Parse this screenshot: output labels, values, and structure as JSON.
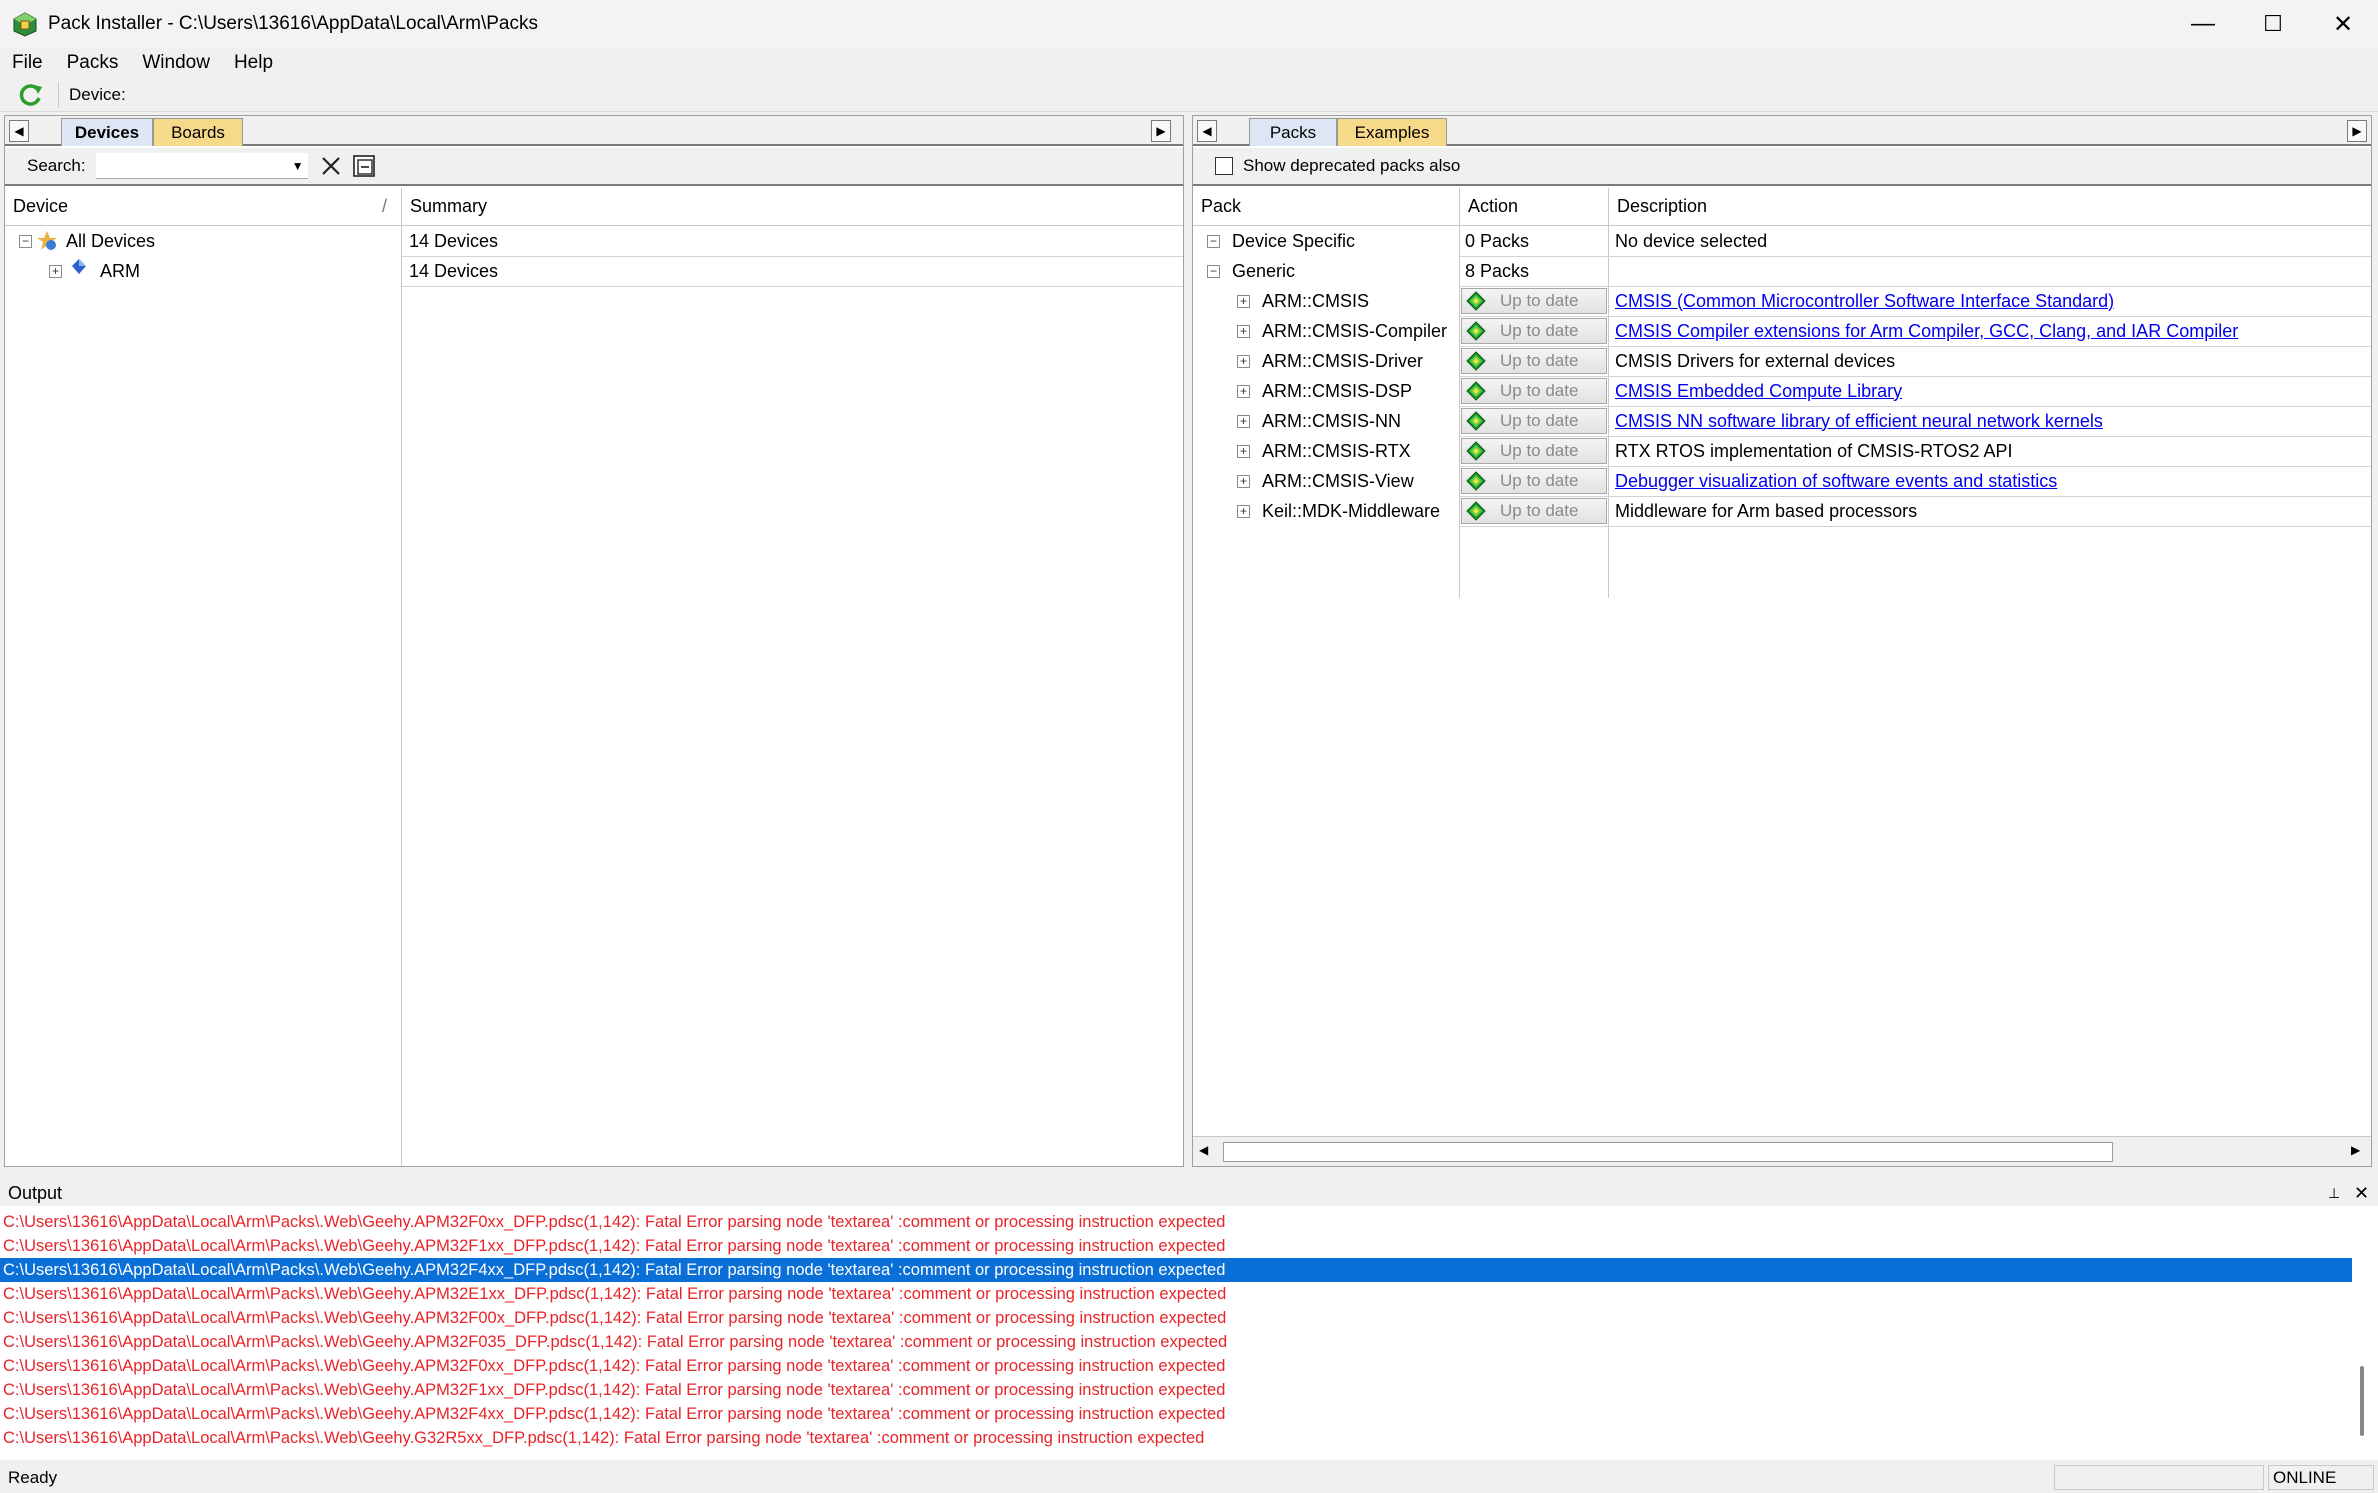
{
  "window": {
    "title": "Pack Installer - C:\\Users\\13616\\AppData\\Local\\Arm\\Packs",
    "minimize_icon": "minimize-icon",
    "maximize_icon": "maximize-icon",
    "close_icon": "close-icon",
    "minimize_glyph": "—",
    "maximize_glyph": "☐",
    "close_glyph": "✕"
  },
  "menu": [
    "File",
    "Packs",
    "Window",
    "Help"
  ],
  "toolbar": {
    "device_label": "Device:"
  },
  "left_pane": {
    "tabs": [
      "Devices",
      "Boards"
    ],
    "search_label": "Search:",
    "search_value": "",
    "headers": {
      "device": "Device",
      "summary": "Summary",
      "sort_glyph": "/"
    },
    "rows": [
      {
        "name": "All Devices",
        "summary": "14 Devices",
        "expander": "−"
      },
      {
        "name": "ARM",
        "summary": "14 Devices",
        "expander": "+"
      }
    ]
  },
  "right_pane": {
    "tabs": [
      "Packs",
      "Examples"
    ],
    "deprecated_label": "Show deprecated packs also",
    "deprecated_checked": false,
    "headers": {
      "pack": "Pack",
      "action": "Action",
      "description": "Description"
    },
    "groups": [
      {
        "name": "Device Specific",
        "action": "0 Packs",
        "description": "No device selected",
        "expander": "−"
      },
      {
        "name": "Generic",
        "action": "8 Packs",
        "description": "",
        "expander": "−"
      }
    ],
    "packs": [
      {
        "name": "ARM::CMSIS",
        "action": "Up to date",
        "description": "CMSIS (Common Microcontroller Software Interface Standard)",
        "link": true
      },
      {
        "name": "ARM::CMSIS-Compiler",
        "action": "Up to date",
        "description": "CMSIS Compiler extensions for Arm Compiler, GCC, Clang, and IAR Compiler",
        "link": true
      },
      {
        "name": "ARM::CMSIS-Driver",
        "action": "Up to date",
        "description": "CMSIS Drivers for external devices",
        "link": false
      },
      {
        "name": "ARM::CMSIS-DSP",
        "action": "Up to date",
        "description": "CMSIS Embedded Compute Library",
        "link": true
      },
      {
        "name": "ARM::CMSIS-NN",
        "action": "Up to date",
        "description": "CMSIS NN software library of efficient neural network kernels",
        "link": true
      },
      {
        "name": "ARM::CMSIS-RTX",
        "action": "Up to date",
        "description": "RTX RTOS implementation of CMSIS-RTOS2 API",
        "link": false
      },
      {
        "name": "ARM::CMSIS-View",
        "action": "Up to date",
        "description": "Debugger visualization of software events and statistics",
        "link": true
      },
      {
        "name": "Keil::MDK-Middleware",
        "action": "Up to date",
        "description": "Middleware for Arm based processors",
        "link": false
      }
    ]
  },
  "output": {
    "title": "Output",
    "lines": [
      "C:\\Users\\13616\\AppData\\Local\\Arm\\Packs\\.Web\\Geehy.APM32F0xx_DFP.pdsc(1,142): Fatal Error parsing node 'textarea' :comment or processing instruction expected",
      "C:\\Users\\13616\\AppData\\Local\\Arm\\Packs\\.Web\\Geehy.APM32F1xx_DFP.pdsc(1,142): Fatal Error parsing node 'textarea' :comment or processing instruction expected",
      "C:\\Users\\13616\\AppData\\Local\\Arm\\Packs\\.Web\\Geehy.APM32F4xx_DFP.pdsc(1,142): Fatal Error parsing node 'textarea' :comment or processing instruction expected",
      "C:\\Users\\13616\\AppData\\Local\\Arm\\Packs\\.Web\\Geehy.APM32E1xx_DFP.pdsc(1,142): Fatal Error parsing node 'textarea' :comment or processing instruction expected",
      "C:\\Users\\13616\\AppData\\Local\\Arm\\Packs\\.Web\\Geehy.APM32F00x_DFP.pdsc(1,142): Fatal Error parsing node 'textarea' :comment or processing instruction expected",
      "C:\\Users\\13616\\AppData\\Local\\Arm\\Packs\\.Web\\Geehy.APM32F035_DFP.pdsc(1,142): Fatal Error parsing node 'textarea' :comment or processing instruction expected",
      "C:\\Users\\13616\\AppData\\Local\\Arm\\Packs\\.Web\\Geehy.APM32F0xx_DFP.pdsc(1,142): Fatal Error parsing node 'textarea' :comment or processing instruction expected",
      "C:\\Users\\13616\\AppData\\Local\\Arm\\Packs\\.Web\\Geehy.APM32F1xx_DFP.pdsc(1,142): Fatal Error parsing node 'textarea' :comment or processing instruction expected",
      "C:\\Users\\13616\\AppData\\Local\\Arm\\Packs\\.Web\\Geehy.APM32F4xx_DFP.pdsc(1,142): Fatal Error parsing node 'textarea' :comment or processing instruction expected",
      "C:\\Users\\13616\\AppData\\Local\\Arm\\Packs\\.Web\\Geehy.G32R5xx_DFP.pdsc(1,142): Fatal Error parsing node 'textarea' :comment or processing instruction expected"
    ],
    "selected_index": 2,
    "pin_glyph": "📌",
    "close_glyph": "✕"
  },
  "status": {
    "text": "Ready",
    "mode": "ONLINE"
  },
  "colors": {
    "error_text": "#e8242a",
    "selection": "#0a6fd6",
    "link": "#0000ee",
    "tab_active": "#dde6f4",
    "tab_inactive": "#f7d98a"
  }
}
